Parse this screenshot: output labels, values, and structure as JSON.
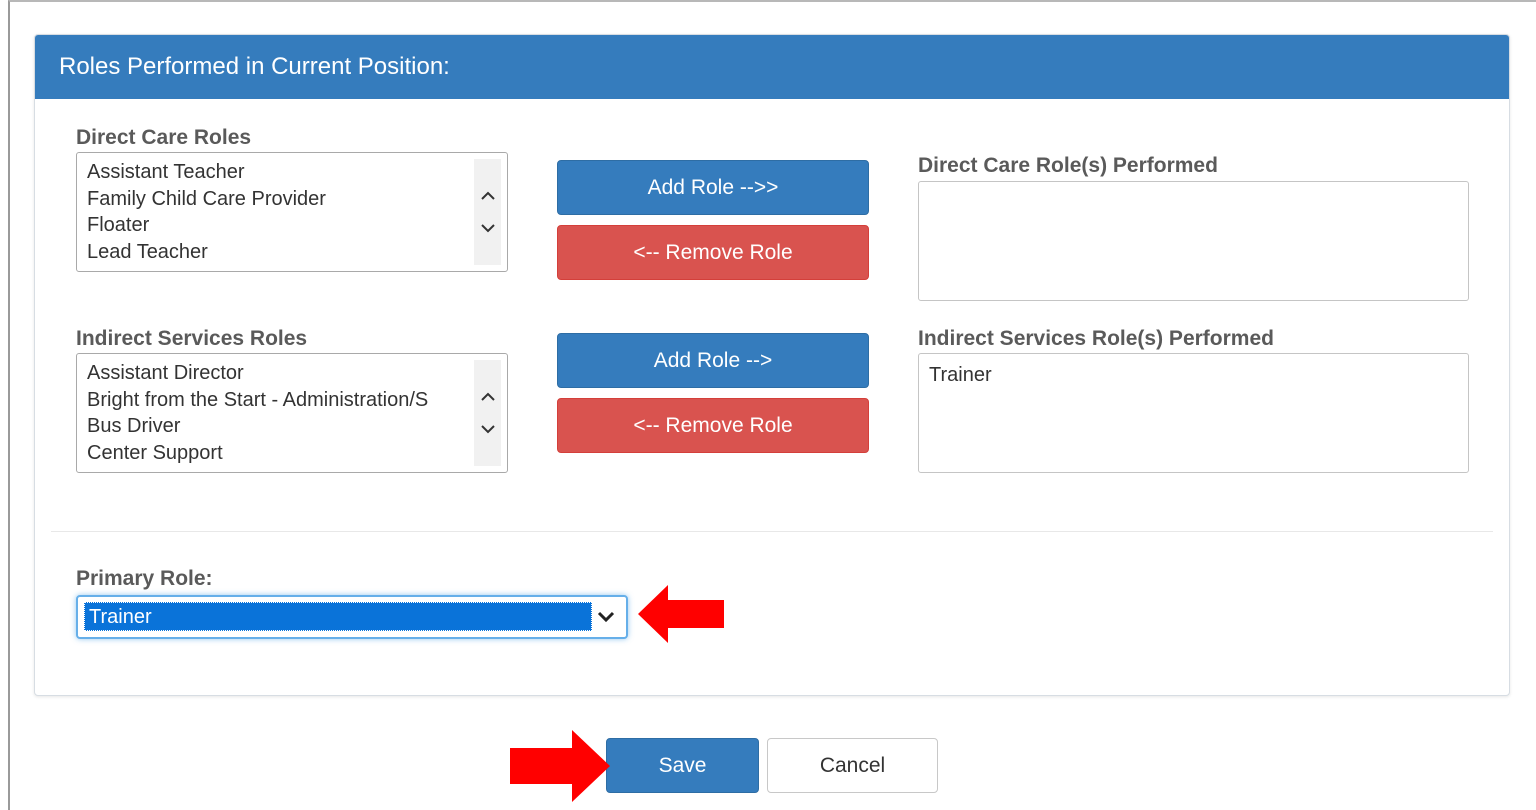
{
  "panel": {
    "title": "Roles Performed in Current Position:"
  },
  "direct": {
    "label": "Direct Care Roles",
    "options": [
      "Assistant Teacher",
      "Family Child Care Provider",
      "Floater",
      "Lead Teacher"
    ],
    "add_label": "Add Role -->>",
    "remove_label": "<-- Remove Role",
    "performed_label": "Direct Care Role(s) Performed",
    "performed_items": []
  },
  "indirect": {
    "label": "Indirect Services Roles",
    "options": [
      "Assistant Director",
      "Bright from the Start - Administration/S",
      "Bus Driver",
      "Center Support"
    ],
    "add_label": "Add Role -->",
    "remove_label": "<-- Remove Role",
    "performed_label": "Indirect Services Role(s) Performed",
    "performed_items": [
      "Trainer"
    ]
  },
  "primary": {
    "label": "Primary Role:",
    "selected": "Trainer"
  },
  "footer": {
    "save_label": "Save",
    "cancel_label": "Cancel"
  },
  "colors": {
    "header": "#357cbd",
    "primary_button": "#357cbd",
    "danger_button": "#d9534f",
    "annotation_arrow": "#ff0000"
  },
  "icons": {
    "scroll_up": "chevron-up-icon",
    "scroll_down": "chevron-down-icon",
    "select_dropdown": "chevron-down-icon",
    "annotation": "red-arrow-icon"
  }
}
